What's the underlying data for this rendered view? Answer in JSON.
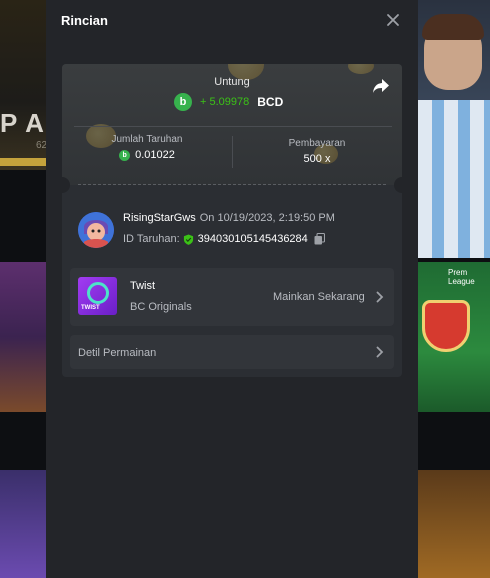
{
  "background": {
    "banner_text": "P A",
    "banner_sub": "62",
    "league_text": "Prem League"
  },
  "modal": {
    "title": "Rincian"
  },
  "summary": {
    "profit_label": "Untung",
    "profit_value": "+ 5.09978",
    "currency": "BCD",
    "coin_glyph": "b",
    "bet_amount_label": "Jumlah Taruhan",
    "bet_amount_value": "0.01022",
    "payout_label": "Pembayaran",
    "payout_value": "500 x"
  },
  "bet": {
    "username": "RisingStarGws",
    "datetime": "On 10/19/2023, 2:19:50 PM",
    "id_label": "ID Taruhan:",
    "id_value": "394030105145436284"
  },
  "game": {
    "name": "Twist",
    "provider": "BC Originals",
    "play_label": "Mainkan Sekarang",
    "thumb_label": "TWIST"
  },
  "details": {
    "label": "Detil Permainan"
  },
  "colors": {
    "accent_green": "#3bc117",
    "coin_green": "#37b24d",
    "modal_bg": "#232529"
  },
  "icons": {
    "close": "close-icon",
    "share": "share-icon",
    "copy": "copy-icon",
    "shield": "shield-icon",
    "chevron": "chevron-right-icon"
  }
}
